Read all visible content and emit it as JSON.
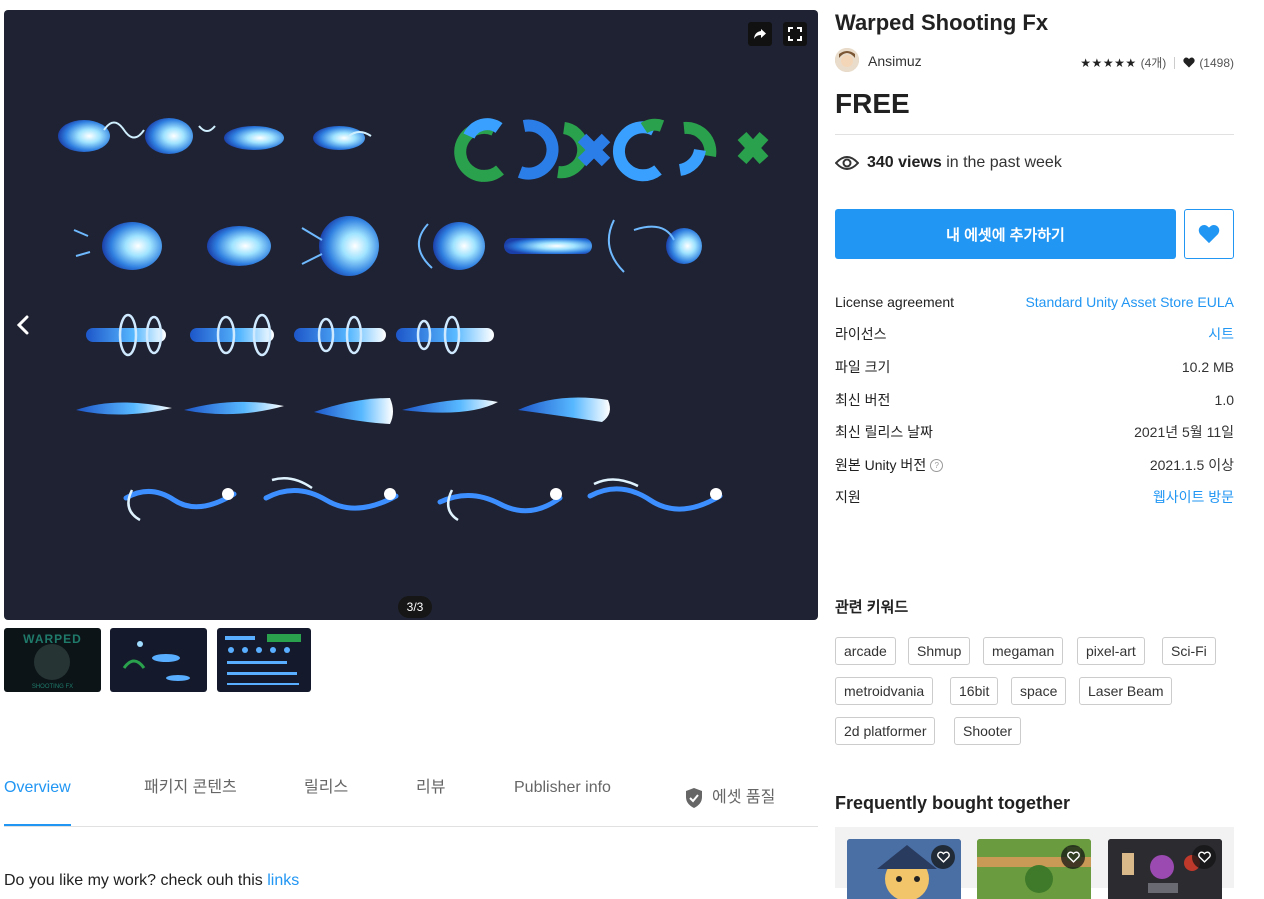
{
  "asset": {
    "title": "Warped Shooting Fx",
    "publisher": "Ansimuz",
    "stars": "★★★★★",
    "rating_count": "(4개)",
    "favorites": "(1498)",
    "price": "FREE"
  },
  "views": {
    "count": "340 views",
    "suffix": "in the past week"
  },
  "actions": {
    "add_label": "내 에셋에 추가하기"
  },
  "viewer": {
    "counter": "3/3",
    "current": 3,
    "total": 3
  },
  "info": [
    {
      "label": "License agreement",
      "value": "Standard Unity Asset Store EULA",
      "link": true
    },
    {
      "label": "라이선스",
      "value": "시트",
      "link": true
    },
    {
      "label": "파일 크기",
      "value": "10.2 MB",
      "link": false
    },
    {
      "label": "최신 버전",
      "value": "1.0",
      "link": false
    },
    {
      "label": "최신 릴리스 날짜",
      "value": "2021년 5월 11일",
      "link": false
    },
    {
      "label": "원본 Unity 버전",
      "value": "2021.1.5 이상",
      "link": false,
      "help": "?"
    },
    {
      "label": "지원",
      "value": "웹사이트 방문",
      "link": true
    }
  ],
  "keywords": {
    "title": "관련 키워드",
    "items": [
      "arcade",
      "Shmup",
      "megaman",
      "pixel-art",
      "Sci-Fi",
      "metroidvania",
      "16bit",
      "space",
      "Laser Beam",
      "2d platformer",
      "Shooter"
    ]
  },
  "tabs": [
    "Overview",
    "패키지 콘텐츠",
    "릴리스",
    "리뷰",
    "Publisher info",
    "에셋 품질"
  ],
  "description": {
    "text": "Do you like my work? check ouh this ",
    "link": "links"
  },
  "thumbnails": {
    "first_logo": "WARPED",
    "first_caption": "SHOOTING FX"
  },
  "fbt": {
    "title": "Frequently bought together"
  },
  "colors": {
    "accent": "#2196f3",
    "viewer_bg": "#1f2232"
  },
  "icons": [
    "share-icon",
    "fullscreen-icon",
    "chevron-left-icon",
    "eye-icon",
    "heart-icon",
    "shield-check-icon",
    "help-icon"
  ]
}
